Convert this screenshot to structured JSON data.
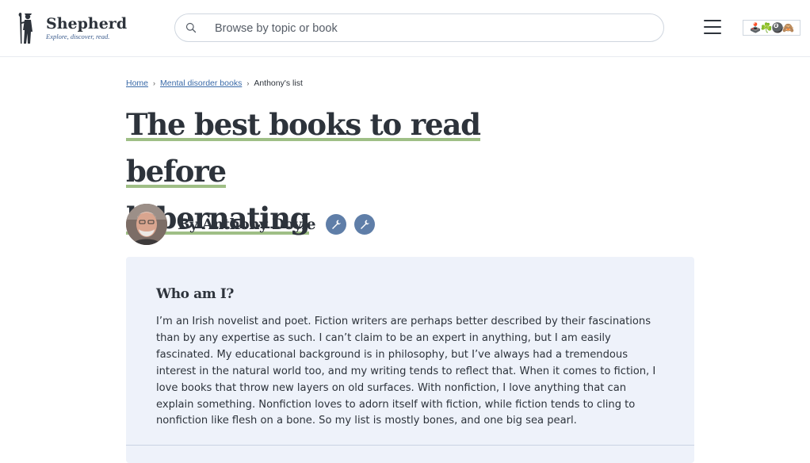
{
  "header": {
    "logo_name": "Shepherd",
    "logo_tagline": "Explore, discover, read.",
    "search_placeholder": "Browse by topic or book",
    "emoji_badge": "🕹️☘️🎱🙈"
  },
  "breadcrumb": {
    "items": [
      "Home",
      "Mental disorder books",
      "Anthony's list"
    ],
    "separator": "›"
  },
  "title": {
    "line1": "The best books to read before",
    "line2": "hibernating"
  },
  "author": {
    "byline": "By Anthony Doyle"
  },
  "who_am_i": {
    "heading": "Who am I?",
    "body": "I’m an Irish novelist and poet. Fiction writers are perhaps better described by their fascinations than by any expertise as such. I can’t claim to be an expert in anything, but I am easily fascinated. My educational background is in philosophy, but I’ve always had a tremendous interest in the natural world too, and my writing tends to reflect that. When it comes to fiction, I love books that throw new layers on old surfaces. With nonfiction, I love anything that can explain something. Nonfiction loves to adorn itself with fiction, while fiction tends to cling to nonfiction like flesh on a bone. So my list is mostly bones, and one big sea pearl."
  },
  "colors": {
    "accent_underline": "#9fbf86",
    "link": "#3a6aa8",
    "badge": "#5f7ea8",
    "panel_bg": "#eef2fa",
    "text": "#2d333b"
  }
}
